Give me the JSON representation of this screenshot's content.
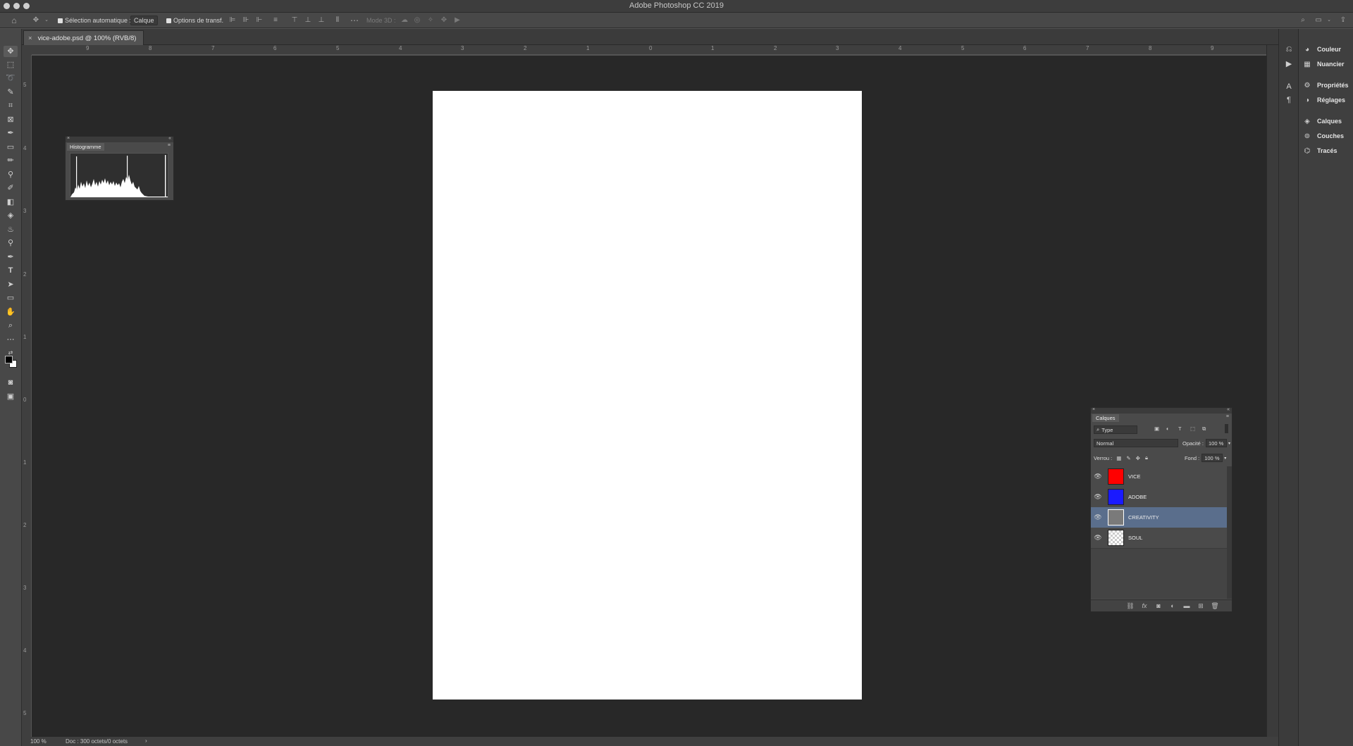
{
  "app": {
    "title": "Adobe Photoshop CC 2019"
  },
  "options_bar": {
    "auto_select_label": "Sélection automatique :",
    "auto_select_value": "Calque",
    "transform_label": "Options de transf.",
    "mode3d_label": "Mode 3D :"
  },
  "document": {
    "tab_title": "vice-adobe.psd @ 100% (RVB/8)",
    "zoom": "100 %",
    "doc_info": "Doc : 300 octets/0 octets"
  },
  "rulers": {
    "top": [
      "9",
      "8",
      "7",
      "6",
      "5",
      "4",
      "3",
      "2",
      "1",
      "0",
      "1",
      "2",
      "3",
      "4",
      "5",
      "6",
      "7",
      "8",
      "9"
    ],
    "left": [
      "5",
      "4",
      "3",
      "2",
      "1",
      "0",
      "1",
      "2",
      "3",
      "4",
      "5"
    ]
  },
  "right_panels": {
    "items": [
      {
        "label": "Couleur",
        "icon": "color-wheel-icon"
      },
      {
        "label": "Nuancier",
        "icon": "swatches-grid-icon"
      },
      {
        "label": "Propriétés",
        "icon": "properties-icon"
      },
      {
        "label": "Réglages",
        "icon": "adjustments-icon"
      },
      {
        "label": "Calques",
        "icon": "layers-icon"
      },
      {
        "label": "Couches",
        "icon": "channels-icon"
      },
      {
        "label": "Tracés",
        "icon": "paths-icon"
      }
    ]
  },
  "histogram_panel": {
    "tab": "Histogramme"
  },
  "layers_panel": {
    "tab": "Calques",
    "filter_kind": "Type",
    "blend_mode": "Normal",
    "opacity_label": "Opacité :",
    "opacity_value": "100 %",
    "lock_label": "Verrou :",
    "fill_label": "Fond :",
    "fill_value": "100 %",
    "layers": [
      {
        "name": "VICE",
        "thumb_color": "#ff0000",
        "selected": false
      },
      {
        "name": "ADOBE",
        "thumb_color": "#1a1aff",
        "selected": false
      },
      {
        "name": "CREATIVITY",
        "thumb_color": "#7a7a7a",
        "selected": true
      },
      {
        "name": "SOUL",
        "thumb_color": "transparent",
        "selected": false
      }
    ]
  }
}
